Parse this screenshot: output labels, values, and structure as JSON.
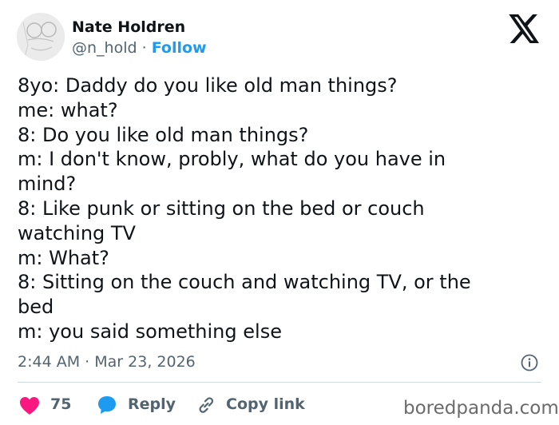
{
  "author": {
    "name": "Nate Holdren",
    "handle": "@n_hold",
    "separator": "·",
    "follow_label": "Follow"
  },
  "tweet": {
    "lines": [
      "8yo: Daddy do you like old man things?",
      "me: what?",
      "8: Do you like old man things?",
      "m: I don't know, probly, what do you have in",
      "mind?",
      "8: Like punk or sitting on the bed or couch",
      "watching TV",
      "m: What?",
      "8: Sitting on the couch and watching TV, or the",
      "bed",
      "m: you said something else"
    ],
    "time": "2:44 AM",
    "date": "Mar 23, 2026"
  },
  "actions": {
    "like_count": "75",
    "reply_label": "Reply",
    "copy_link_label": "Copy link"
  },
  "watermark": "boredpanda.com",
  "icons": {
    "avatar": "avatar-sketch",
    "logo": "x-logo-icon",
    "info": "info-icon",
    "like": "heart-icon",
    "reply": "speech-bubble-icon",
    "link": "link-icon"
  },
  "colors": {
    "text": "#0f1419",
    "secondary": "#536471",
    "accent": "#1d9bf0",
    "like": "#f91880",
    "divider": "#cfd9de"
  }
}
